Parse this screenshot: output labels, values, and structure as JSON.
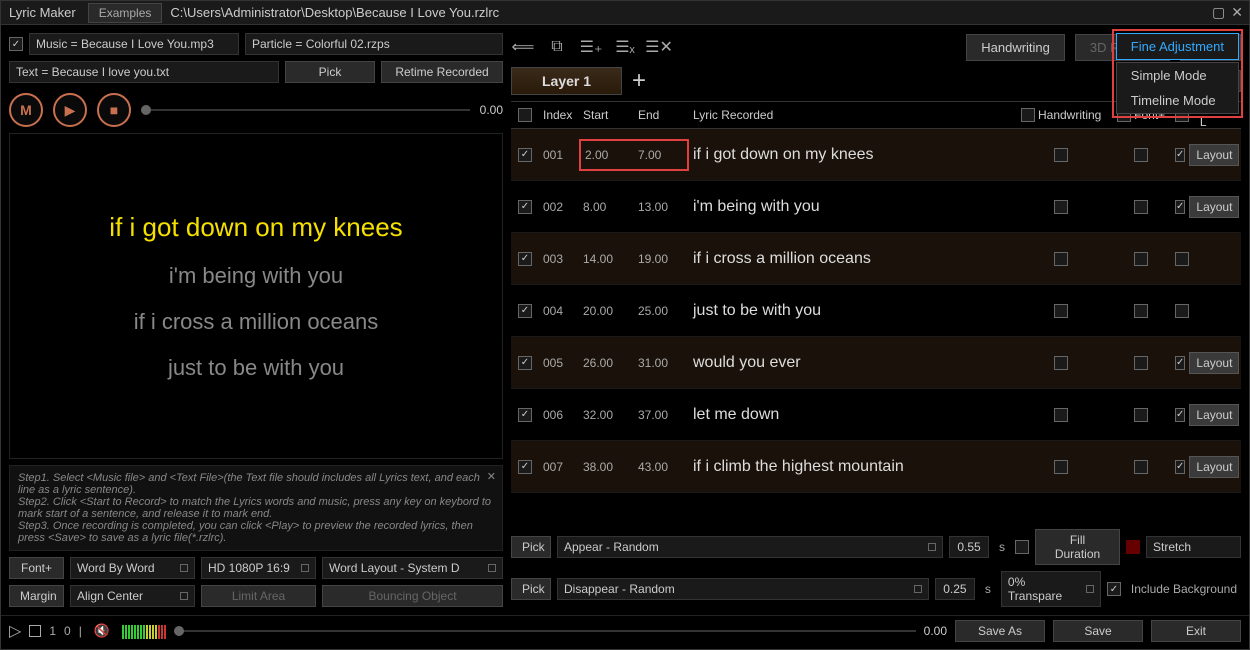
{
  "title": "Lyric Maker",
  "examples_btn": "Examples",
  "filepath": "C:\\Users\\Administrator\\Desktop\\Because I Love You.rzlrc",
  "left": {
    "music_field": "Music = Because I Love You.mp3",
    "particle_field": "Particle = Colorful 02.rzps",
    "text_field": "Text = Because I love you.txt",
    "pick_btn": "Pick",
    "retime_btn": "Retime Recorded",
    "m_btn": "M",
    "time": "0.00",
    "preview": {
      "l1": "if i got down on my knees",
      "l2": "i'm being with you",
      "l3": "if i cross a million oceans",
      "l4": "just to be with you"
    },
    "help": {
      "s1": "Step1. Select <Music file> and <Text File>(the Text file should includes all Lyrics text, and each line as a lyric sentence).",
      "s2": "Step2. Click <Start to Record> to match the Lyrics words and music, press any key on keybord to mark start of a sentence, and release it to mark end.",
      "s3": "Step3. Once recording is completed, you can click <Play> to preview the recorded lyrics, then press <Save> to save as a lyric file(*.rzlrc)."
    },
    "font_btn": "Font+",
    "word_by_word": "Word By Word",
    "resolution": "HD 1080P 16:9",
    "word_layout": "Word Layout - System D",
    "margin_btn": "Margin",
    "align": "Align Center",
    "limit_area": "Limit Area",
    "bouncing": "Bouncing Object"
  },
  "right": {
    "modes": {
      "hw": "Handwriting",
      "rhythm": "3D Rhythm",
      "mask": "Mask",
      "fine": "Fine Adjustment"
    },
    "dropdown": {
      "simple": "Simple Mode",
      "timeline": "Timeline Mode"
    },
    "layer_tab": "Layer 1",
    "font_btn_r": "Fo",
    "headers": {
      "index": "Index",
      "start": "Start",
      "end": "End",
      "lyric": "Lyric Recorded",
      "hw": "Handwriting",
      "font": "Font+",
      "layout": "Word L"
    },
    "rows": [
      {
        "idx": "001",
        "start": "2.00",
        "end": "7.00",
        "lyric": "if i got down on my knees",
        "layout": true
      },
      {
        "idx": "002",
        "start": "8.00",
        "end": "13.00",
        "lyric": "i'm being with you",
        "layout": true
      },
      {
        "idx": "003",
        "start": "14.00",
        "end": "19.00",
        "lyric": "if i cross a million oceans",
        "layout": false
      },
      {
        "idx": "004",
        "start": "20.00",
        "end": "25.00",
        "lyric": "just to be with you",
        "layout": false
      },
      {
        "idx": "005",
        "start": "26.00",
        "end": "31.00",
        "lyric": "would you ever",
        "layout": true
      },
      {
        "idx": "006",
        "start": "32.00",
        "end": "37.00",
        "lyric": "let me down",
        "layout": true
      },
      {
        "idx": "007",
        "start": "38.00",
        "end": "43.00",
        "lyric": "if i climb the highest mountain",
        "layout": true
      }
    ],
    "layout_btn": "Layout",
    "bottom": {
      "pick": "Pick",
      "appear": "Appear - Random",
      "appear_val": "0.55",
      "s": "s",
      "fill": "Fill Duration",
      "stretch": "Stretch",
      "disappear": "Disappear - Random",
      "disappear_val": "0.25",
      "trans": "0% Transpare",
      "include_bg": "Include Background"
    }
  },
  "bottombar": {
    "counter": "1",
    "zero": "0",
    "time": "0.00",
    "save_as": "Save As",
    "save": "Save",
    "exit": "Exit"
  }
}
